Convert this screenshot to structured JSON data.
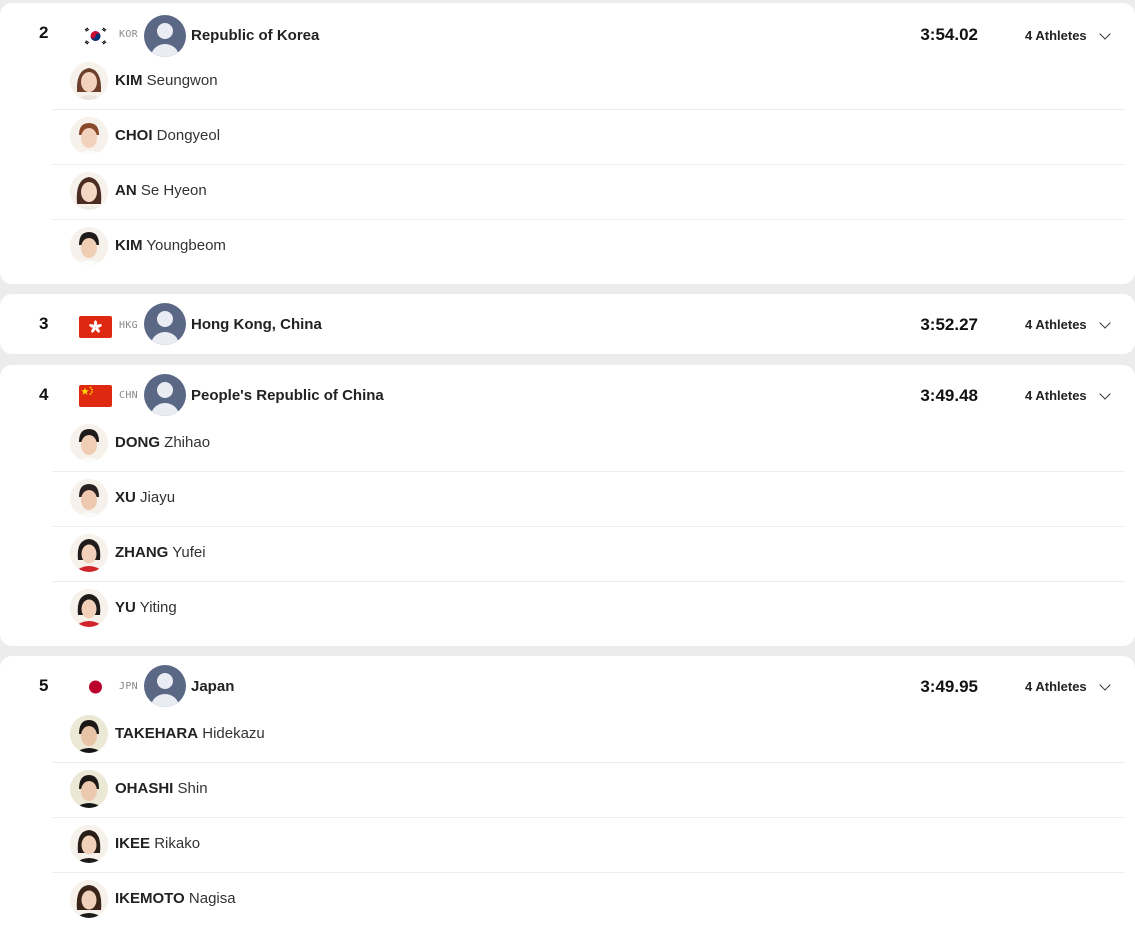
{
  "teams": [
    {
      "rank": "2",
      "code": "KOR",
      "name": "Republic of Korea",
      "time": "3:54.02",
      "athletes_label": "4 Athletes",
      "flag": "korea-flag",
      "athletes": [
        {
          "family": "KIM",
          "given": "Seungwon"
        },
        {
          "family": "CHOI",
          "given": "Dongyeol"
        },
        {
          "family": "AN",
          "given": "Se Hyeon"
        },
        {
          "family": "KIM",
          "given": "Youngbeom"
        }
      ]
    },
    {
      "rank": "3",
      "code": "HKG",
      "name": "Hong Kong, China",
      "time": "3:52.27",
      "athletes_label": "4 Athletes",
      "flag": "hong-kong-flag",
      "athletes": []
    },
    {
      "rank": "4",
      "code": "CHN",
      "name": "People's Republic of China",
      "time": "3:49.48",
      "athletes_label": "4 Athletes",
      "flag": "china-flag",
      "athletes": [
        {
          "family": "DONG",
          "given": "Zhihao"
        },
        {
          "family": "XU",
          "given": "Jiayu"
        },
        {
          "family": "ZHANG",
          "given": "Yufei"
        },
        {
          "family": "YU",
          "given": "Yiting"
        }
      ]
    },
    {
      "rank": "5",
      "code": "JPN",
      "name": "Japan",
      "time": "3:49.95",
      "athletes_label": "4 Athletes",
      "flag": "japan-flag",
      "athletes": [
        {
          "family": "TAKEHARA",
          "given": "Hidekazu"
        },
        {
          "family": "OHASHI",
          "given": "Shin"
        },
        {
          "family": "IKEE",
          "given": "Rikako"
        },
        {
          "family": "IKEMOTO",
          "given": "Nagisa"
        }
      ]
    }
  ],
  "colors": {
    "background": "#ececec",
    "card": "#ffffff",
    "avatar": "#5a6785",
    "red": "#de2910"
  }
}
